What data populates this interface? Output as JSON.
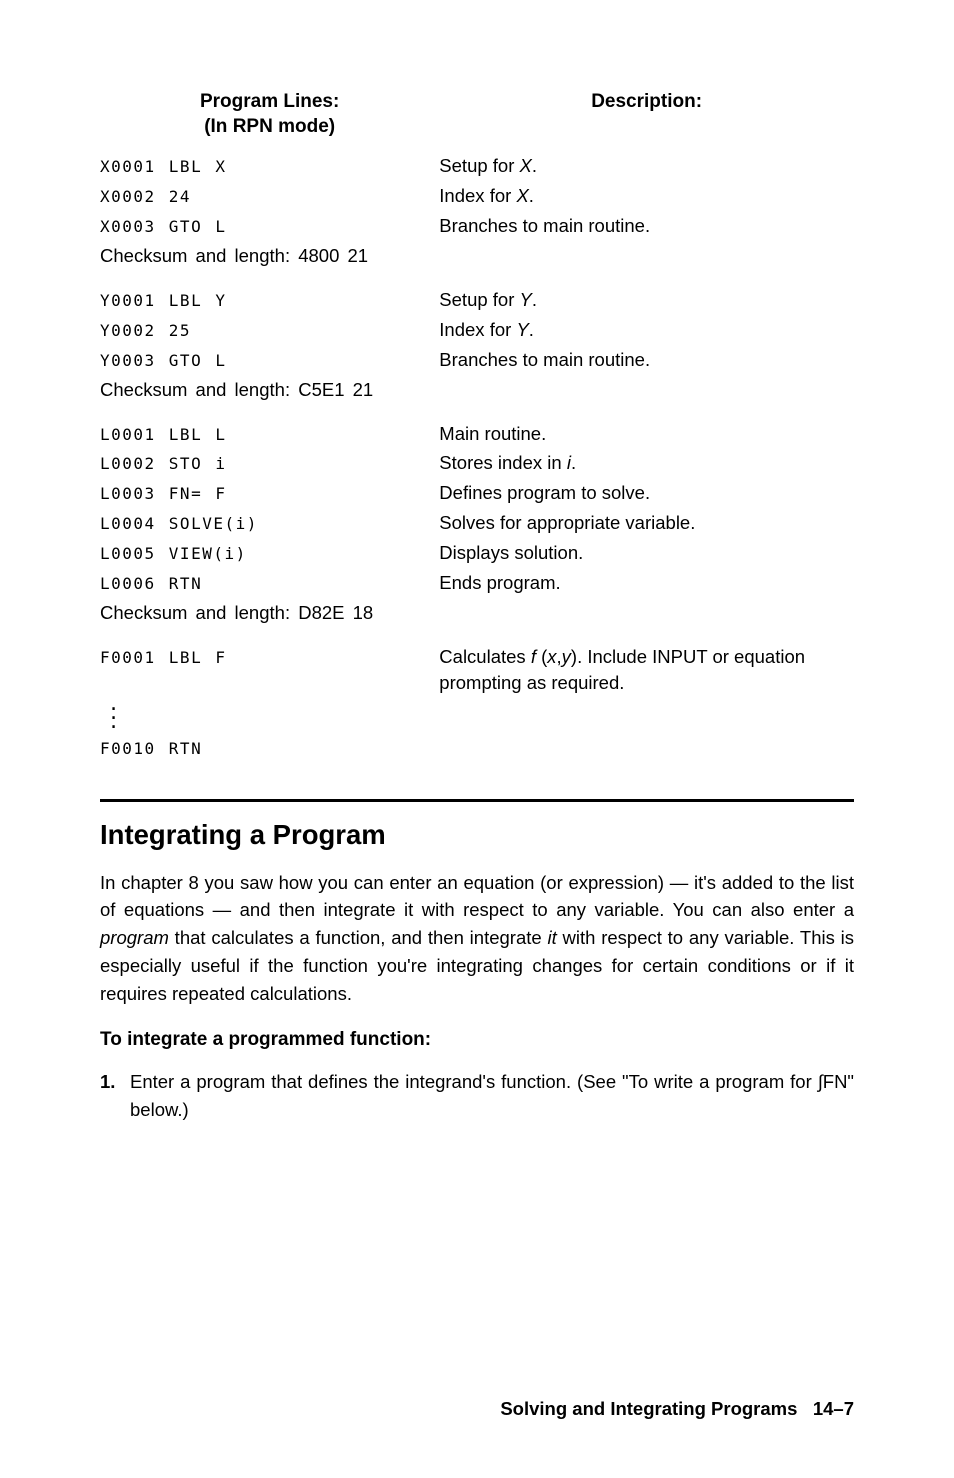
{
  "headers": {
    "left_line1": "Program Lines:",
    "left_line2": "(In RPN mode)",
    "right": "Description:"
  },
  "blocks": [
    {
      "rows": [
        {
          "code": "X0001 LBL X",
          "desc_pre": "Setup for ",
          "desc_it": "X",
          "desc_post": "."
        },
        {
          "code": "X0002 24",
          "desc_pre": "Index for ",
          "desc_it": "X",
          "desc_post": "."
        },
        {
          "code": "X0003 GTO L",
          "desc_pre": "Branches to main routine.",
          "desc_it": "",
          "desc_post": ""
        }
      ],
      "checksum": "Checksum and length: 4800   21"
    },
    {
      "rows": [
        {
          "code": "Y0001 LBL Y",
          "desc_pre": "Setup for ",
          "desc_it": "Y",
          "desc_post": "."
        },
        {
          "code": "Y0002 25",
          "desc_pre": "Index for ",
          "desc_it": "Y",
          "desc_post": "."
        },
        {
          "code": "Y0003 GTO L",
          "desc_pre": "Branches to main routine.",
          "desc_it": "",
          "desc_post": ""
        }
      ],
      "checksum": "Checksum and length: C5E1   21"
    },
    {
      "rows": [
        {
          "code": "L0001 LBL L",
          "desc_pre": "Main routine.",
          "desc_it": "",
          "desc_post": ""
        },
        {
          "code": "L0002 STO i",
          "desc_pre": "Stores index in ",
          "desc_it": "i",
          "desc_post": "."
        },
        {
          "code": "L0003 FN= F",
          "desc_pre": "Defines program to solve.",
          "desc_it": "",
          "desc_post": ""
        },
        {
          "code": "L0004 SOLVE(i)",
          "desc_pre": "Solves for appropriate variable.",
          "desc_it": "",
          "desc_post": ""
        },
        {
          "code": "L0005 VIEW(i)",
          "desc_pre": "Displays solution.",
          "desc_it": "",
          "desc_post": ""
        },
        {
          "code": "L0006 RTN",
          "desc_pre": "Ends program.",
          "desc_it": "",
          "desc_post": ""
        }
      ],
      "checksum": "Checksum and length: D82E   18"
    }
  ],
  "fblock": {
    "first_code": "F0001 LBL F",
    "desc_pre": "Calculates ",
    "desc_it": "f ",
    "desc_mid1": "(",
    "desc_it2": "x",
    "desc_mid2": ",",
    "desc_it3": "y",
    "desc_post": "). Include INPUT or equation prompting as required.",
    "last_code": "F0010 RTN"
  },
  "section_title": "Integrating a Program",
  "para": {
    "t1": "In chapter 8 you saw how you can enter an equation (or expression) — it's added to the list of equations — and then integrate it with respect to any variable. You can also enter a ",
    "it1": "program",
    "t2": " that calculates a function, and then integrate ",
    "it2": "it",
    "t3": " with respect to any variable. This is especially useful if the function you're integrating changes for certain conditions or if it requires repeated calculations."
  },
  "sub_title": "To integrate a programmed function:",
  "list_item": {
    "num": "1.",
    "text": "Enter a program that defines the integrand's function. (See \"To write a program for ∫FN\" below.)"
  },
  "footer": {
    "title": "Solving and Integrating Programs",
    "page": "14–7"
  }
}
